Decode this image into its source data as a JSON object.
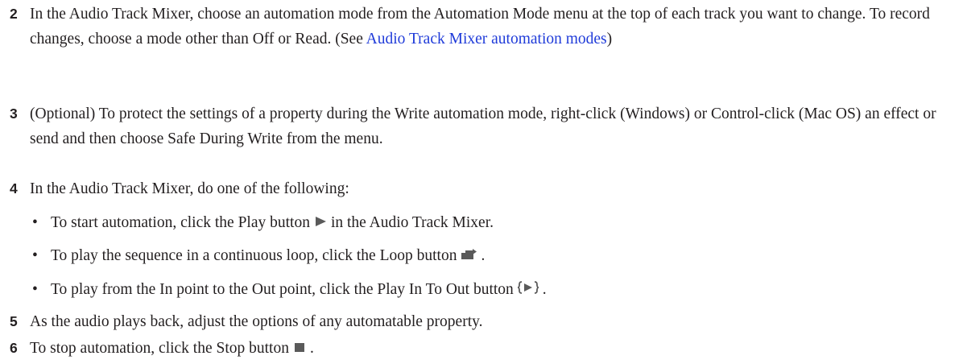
{
  "steps": [
    {
      "number": "2",
      "text": "In the Audio Track Mixer, choose an automation mode from the Automation Mode menu at the top of each track you want to change. To record changes, choose a mode other than Off or Read. (See ",
      "link": "Audio Track Mixer automation modes",
      "after_link": ")"
    },
    {
      "number": "3",
      "text": "(Optional) To protect the settings of a property during the Write automation mode, right-click (Windows) or Control-click (Mac OS) an effect or send and then choose Safe During Write from the menu."
    },
    {
      "number": "4",
      "text": "In the Audio Track Mixer, do one of the following:"
    },
    {
      "number": "5",
      "text": "As the audio plays back, adjust the options of any automatable property."
    },
    {
      "number": "6",
      "text_before": "To stop automation, click the Stop button",
      "text_after": ".",
      "icon": "stop-icon"
    }
  ],
  "bullets": [
    {
      "marker": "•",
      "text_before": "To start automation, click the Play button",
      "text_after": "in the Audio Track Mixer.",
      "icon": "play-icon"
    },
    {
      "marker": "•",
      "text_before": "To play the sequence in a continuous loop, click the Loop button",
      "text_after": ".",
      "icon": "loop-icon"
    },
    {
      "marker": "•",
      "text_before": "To play from the In point to the Out point, click the Play In To Out button",
      "text_after": ".",
      "icon": "play-in-to-out-icon"
    }
  ],
  "colors": {
    "text": "#231f20",
    "link": "#1f3bd9",
    "icon": "#555555"
  }
}
